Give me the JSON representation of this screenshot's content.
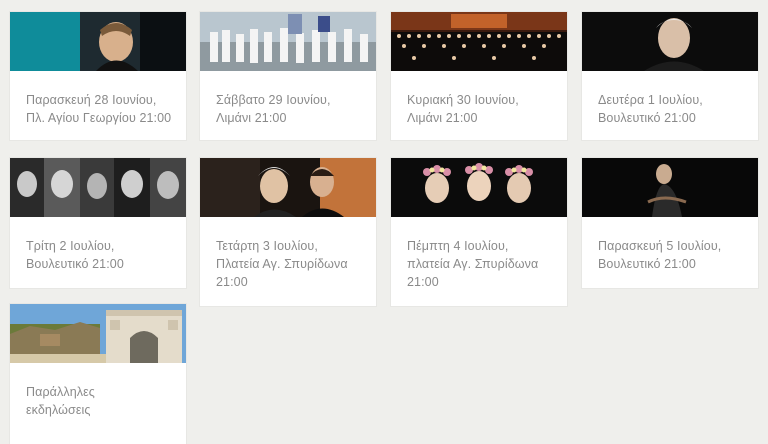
{
  "events": [
    {
      "line1": "Παρασκευή 28 Ιουνίου,",
      "line2": "Πλ. Αγίου Γεωργίου 21:00",
      "line3": ""
    },
    {
      "line1": "Σάββατο 29 Ιουνίου,",
      "line2": "Λιμάνι 21:00",
      "line3": ""
    },
    {
      "line1": "Κυριακή 30 Ιουνίου,",
      "line2": "Λιμάνι 21:00",
      "line3": ""
    },
    {
      "line1": "Δευτέρα 1 Ιουλίου,",
      "line2": "Βουλευτικό 21:00",
      "line3": ""
    },
    {
      "line1": "Τρίτη 2 Ιουλίου,",
      "line2": "Βουλευτικό 21:00",
      "line3": ""
    },
    {
      "line1": "Τετάρτη 3 Ιουλίου,",
      "line2": "Πλατεία Αγ. Σπυρίδωνα",
      "line3": "21:00"
    },
    {
      "line1": "Πέμπτη 4 Ιουλίου,",
      "line2": "πλατεία Αγ. Σπυρίδωνα",
      "line3": "21:00"
    },
    {
      "line1": "Παρασκευή 5 Ιουλίου,",
      "line2": "Βουλευτικό 21:00",
      "line3": ""
    },
    {
      "line1": "Παράλληλες",
      "line2": "εκδηλώσεις",
      "line3": ""
    }
  ]
}
